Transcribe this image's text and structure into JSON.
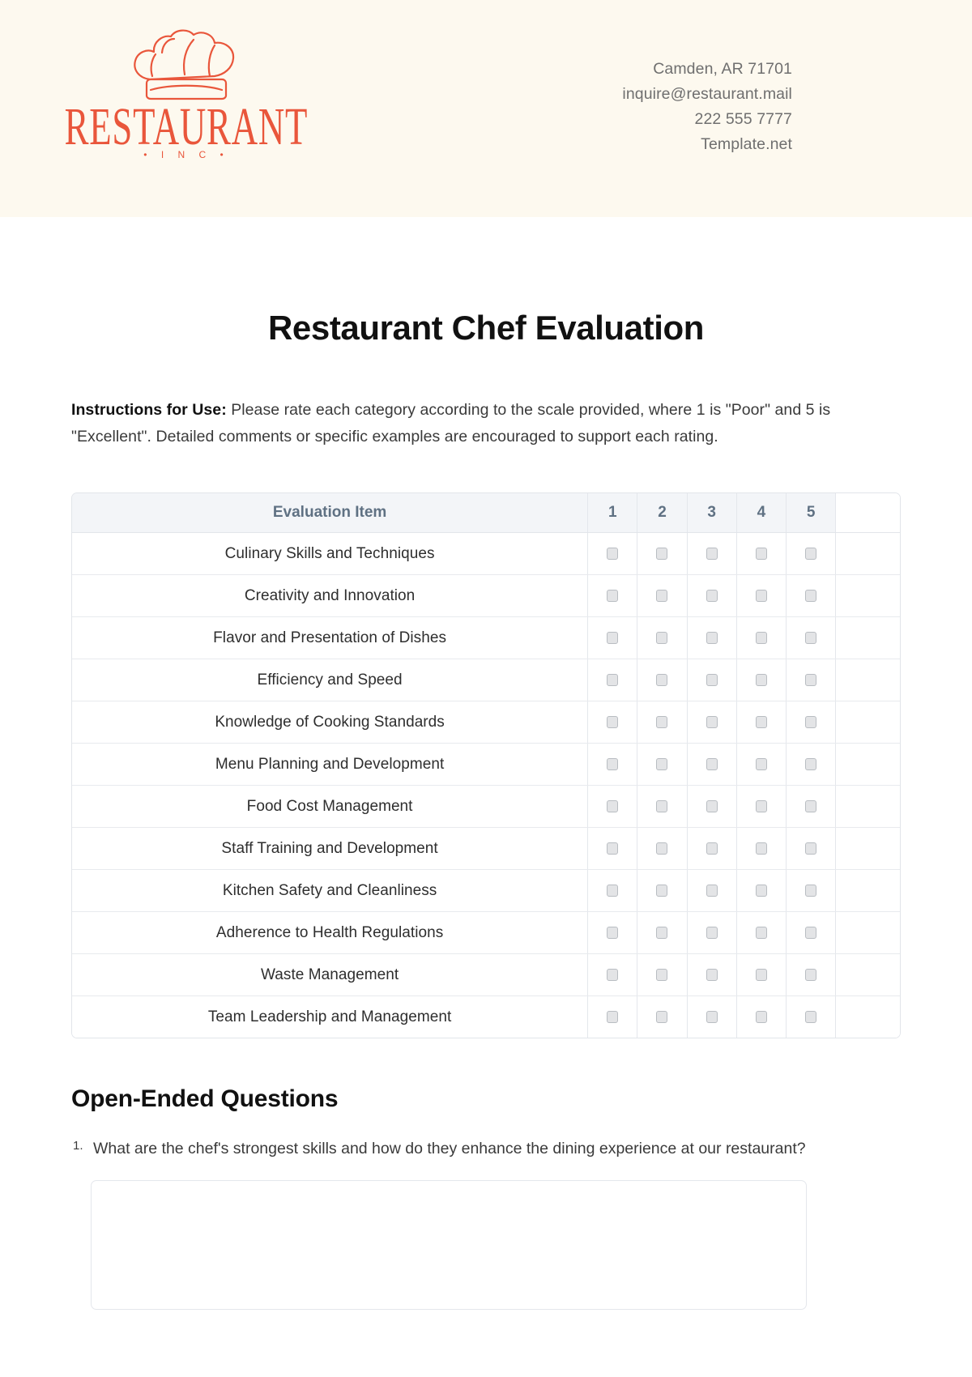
{
  "brand": {
    "logo_icon": "chef-hat-icon",
    "wordmark": "RESTAURANT",
    "sub_wordmark": "• I N C •",
    "accent_color": "#e9563b",
    "band_color": "#fdf9ef"
  },
  "contact": {
    "address": "Camden, AR 71701",
    "email": "inquire@restaurant.mail",
    "phone": "222 555 7777",
    "website": "Template.net"
  },
  "document": {
    "title": "Restaurant Chef Evaluation",
    "instructions_label": "Instructions for Use:",
    "instructions_text": " Please rate each category according to the scale provided, where 1 is \"Poor\" and 5 is \"Excellent\". Detailed comments or specific examples are encouraged to support each rating."
  },
  "rating_table": {
    "header_item": "Evaluation Item",
    "scale": [
      "1",
      "2",
      "3",
      "4",
      "5"
    ],
    "rows": [
      "Culinary Skills and Techniques",
      "Creativity and Innovation",
      "Flavor and Presentation of Dishes",
      "Efficiency and Speed",
      "Knowledge of Cooking Standards",
      "Menu Planning and Development",
      "Food Cost Management",
      "Staff Training and Development",
      "Kitchen Safety and Cleanliness",
      "Adherence to Health Regulations",
      "Waste Management",
      "Team Leadership and Management"
    ]
  },
  "open_ended": {
    "heading": "Open-Ended Questions",
    "questions": [
      {
        "number": "1.",
        "text": "What are the chef's strongest skills and how do they enhance the dining experience at our restaurant?",
        "answer_value": "",
        "answer_placeholder": ""
      }
    ]
  }
}
